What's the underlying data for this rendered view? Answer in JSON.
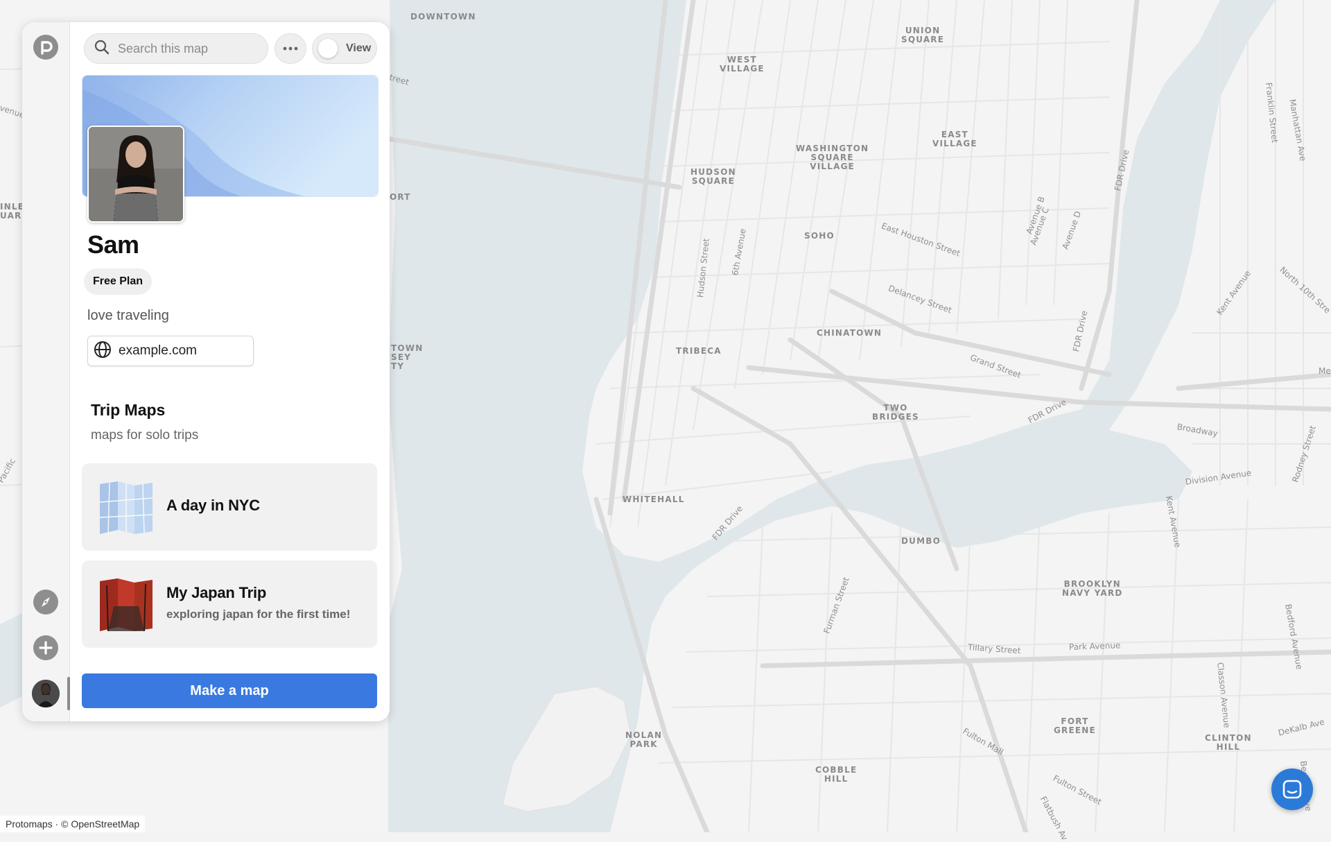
{
  "map": {
    "place_labels": [
      {
        "text": "DOWNTOWN"
      },
      {
        "text": "UNION\nSQUARE"
      },
      {
        "text": "WEST\nVILLAGE"
      },
      {
        "text": "EAST\nVILLAGE"
      },
      {
        "text": "WASHINGTON\nSQUARE\nVILLAGE"
      },
      {
        "text": "HUDSON\nSQUARE"
      },
      {
        "text": "SOHO"
      },
      {
        "text": "CHINATOWN"
      },
      {
        "text": "TRIBECA"
      },
      {
        "text": "TWO\nBRIDGES"
      },
      {
        "text": "WHITEHALL"
      },
      {
        "text": "DUMBO"
      },
      {
        "text": "BROOKLYN\nNAVY YARD"
      },
      {
        "text": "NOLAN\nPARK"
      },
      {
        "text": "COBBLE\nHILL"
      },
      {
        "text": "FORT\nGREENE"
      },
      {
        "text": "CLINTON\nHILL"
      },
      {
        "text": "INLE\nUARE"
      },
      {
        "text": "ORT"
      },
      {
        "text": "TOWN\nSEY\nTY"
      }
    ],
    "street_labels": [
      {
        "text": "East Houston Street"
      },
      {
        "text": "Delancey Street"
      },
      {
        "text": "Grand Street"
      },
      {
        "text": "FDR Drive"
      },
      {
        "text": "FDR Drive"
      },
      {
        "text": "FDR Drive"
      },
      {
        "text": "FDR Drive"
      },
      {
        "text": "Hudson Street"
      },
      {
        "text": "6th Avenue"
      },
      {
        "text": "Avenue B"
      },
      {
        "text": "Avenue C"
      },
      {
        "text": "Avenue D"
      },
      {
        "text": "Broadway"
      },
      {
        "text": "Division Avenue"
      },
      {
        "text": "Kent Avenue"
      },
      {
        "text": "Kent Avenue"
      },
      {
        "text": "North 10th Stre"
      },
      {
        "text": "Franklin Street"
      },
      {
        "text": "Manhattan Ave"
      },
      {
        "text": "Rodney Street"
      },
      {
        "text": "Bedford Avenue"
      },
      {
        "text": "Classon Avenue"
      },
      {
        "text": "Park Avenue"
      },
      {
        "text": "Tillary Street"
      },
      {
        "text": "Furman Street"
      },
      {
        "text": "Fulton Mall"
      },
      {
        "text": "Fulton Street"
      },
      {
        "text": "Flatbush Av"
      },
      {
        "text": "DeKalb Ave"
      },
      {
        "text": "Bedford Ave"
      },
      {
        "text": "Pacific"
      },
      {
        "text": "venue"
      },
      {
        "text": "treet"
      },
      {
        "text": "Me"
      }
    ]
  },
  "sidebar": {
    "logo_icon": "protomaps-logo-icon",
    "explore_icon": "compass-icon",
    "add_icon": "plus-icon"
  },
  "search": {
    "placeholder": "Search this map"
  },
  "toolbar": {
    "more_label": "•••",
    "view_label": "View"
  },
  "profile": {
    "name": "Sam",
    "plan": "Free Plan",
    "bio": "love traveling",
    "website": "example.com"
  },
  "collection": {
    "title": "Trip Maps",
    "subtitle": "maps for solo trips",
    "maps": [
      {
        "title": "A day in NYC",
        "subtitle": ""
      },
      {
        "title": "My Japan Trip",
        "subtitle": "exploring japan for the first time!"
      }
    ]
  },
  "actions": {
    "make_map": "Make a map"
  },
  "attribution": "Protomaps · © OpenStreetMap",
  "colors": {
    "water": "#dfe7eb",
    "land": "#f4f4f4",
    "road": "#e3e3e3",
    "primary_button": "#3a7ae0",
    "chat_button": "#2b7ad8"
  }
}
